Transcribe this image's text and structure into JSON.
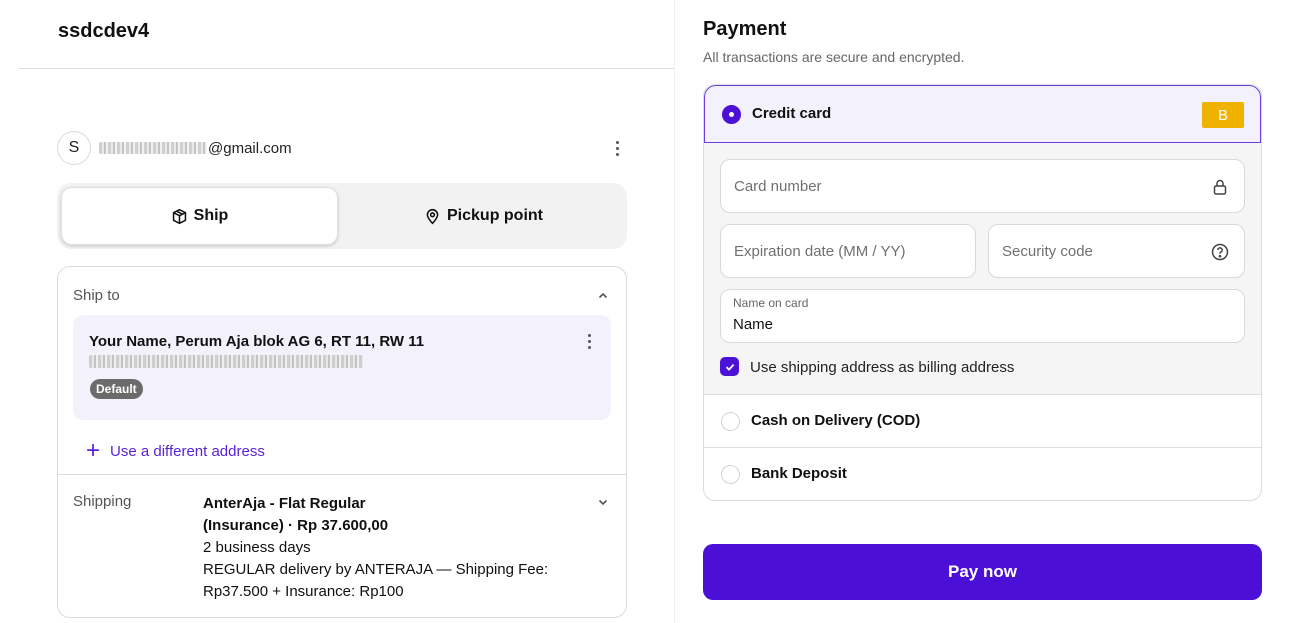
{
  "store": {
    "name": "ssdcdev4"
  },
  "account": {
    "avatar_letter": "S",
    "email_suffix": "@gmail.com"
  },
  "delivery_toggle": {
    "ship_label": "Ship",
    "pickup_label": "Pickup point",
    "selected": "Ship"
  },
  "ship_to": {
    "label": "Ship to",
    "address_name": "Your Name, Perum Aja blok AG 6, RT 11, RW 11",
    "badge": "Default",
    "use_different": "Use a different address"
  },
  "shipping": {
    "label": "Shipping",
    "method_line1": "AnterAja - Flat Regular",
    "method_line2": "(Insurance) · Rp 37.600,00",
    "duration": "2 business days",
    "description": "REGULAR delivery by ANTERAJA — Shipping Fee: Rp37.500 + Insurance: Rp100"
  },
  "payment": {
    "title": "Payment",
    "subtitle": "All transactions are secure and encrypted.",
    "credit_card_label": "Credit card",
    "card_brand_letter": "B",
    "card_number_placeholder": "Card number",
    "expiry_placeholder": "Expiration date (MM / YY)",
    "security_placeholder": "Security code",
    "name_label": "Name on card",
    "name_value": "Name",
    "billing_checkbox": "Use shipping address as billing address",
    "cod_label": "Cash on Delivery (COD)",
    "bank_label": "Bank Deposit",
    "selected_method": "Credit card"
  },
  "pay_button": "Pay now",
  "colors": {
    "accent": "#4c0fd8",
    "selected_bg": "#f3f1fc",
    "card_logo": "#f0b200",
    "badge": "#6b6b6b"
  }
}
